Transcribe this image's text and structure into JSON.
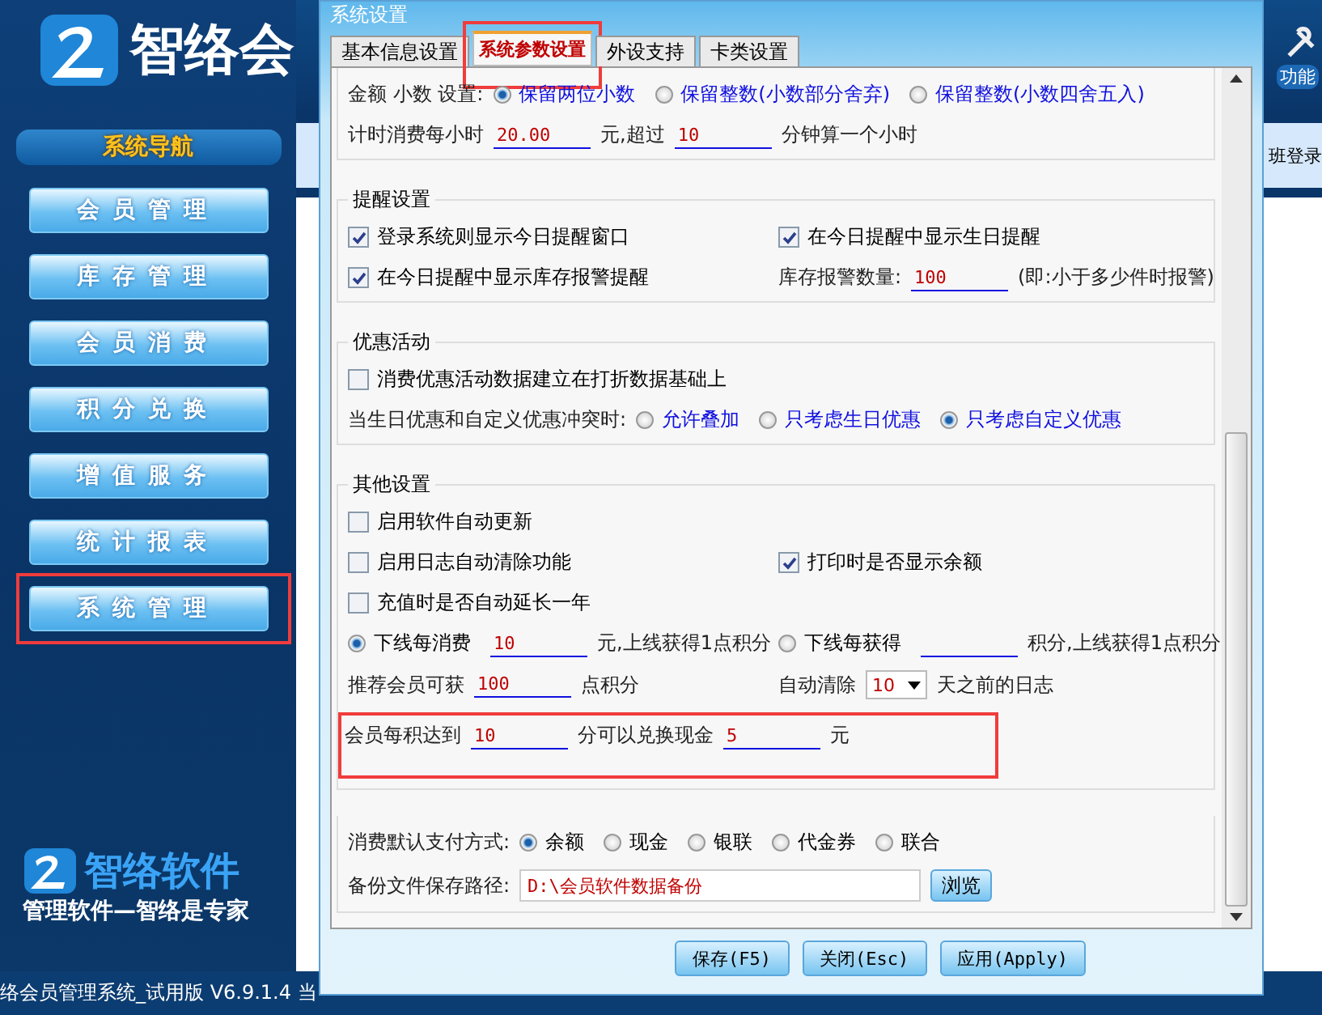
{
  "app": {
    "logo_text": "智络会",
    "nav_title": "系统导航",
    "nav_items": [
      {
        "label": "会员管理",
        "highlighted": false
      },
      {
        "label": "库存管理",
        "highlighted": false
      },
      {
        "label": "会员消费",
        "highlighted": false
      },
      {
        "label": "积分兑换",
        "highlighted": false
      },
      {
        "label": "增值服务",
        "highlighted": false
      },
      {
        "label": "统计报表",
        "highlighted": false
      },
      {
        "label": "系统管理",
        "highlighted": true
      }
    ],
    "brand_name": "智络软件",
    "slogan": "管理软件—智络是专家",
    "toolbar_label": "功能",
    "login_label": "班登录",
    "status_text": "络会员管理系统_试用版 V6.9.1.4 当"
  },
  "dialog": {
    "title": "系统设置",
    "tabs": [
      {
        "label": "基本信息设置",
        "selected": false,
        "highlighted": false
      },
      {
        "label": "系统参数设置",
        "selected": true,
        "highlighted": true
      },
      {
        "label": "外设支持",
        "selected": false,
        "highlighted": false
      },
      {
        "label": "卡类设置",
        "selected": false,
        "highlighted": false
      }
    ],
    "sections": [
      {
        "rows": [
          {
            "left": [
              {
                "kind": "label",
                "text": "金额 小数 设置:"
              },
              {
                "kind": "radio",
                "text": "保留两位小数",
                "selected": true,
                "accent": true
              },
              {
                "kind": "radio",
                "text": "保留整数(小数部分舍弃)",
                "selected": false,
                "accent": true
              },
              {
                "kind": "radio",
                "text": "保留整数(小数四舍五入)",
                "selected": false,
                "accent": true
              }
            ]
          },
          {
            "left": [
              {
                "kind": "label",
                "text": "计时消费每小时"
              },
              {
                "kind": "field",
                "value": "20.00"
              },
              {
                "kind": "label",
                "text": "元,超过"
              },
              {
                "kind": "field",
                "value": "10"
              },
              {
                "kind": "label",
                "text": "分钟算一个小时"
              }
            ]
          }
        ]
      },
      {
        "title": "提醒设置",
        "rows": [
          {
            "left": [
              {
                "kind": "checkbox",
                "text": "登录系统则显示今日提醒窗口",
                "checked": true
              }
            ],
            "right": [
              {
                "kind": "checkbox",
                "text": "在今日提醒中显示生日提醒",
                "checked": true
              }
            ]
          },
          {
            "left": [
              {
                "kind": "checkbox",
                "text": "在今日提醒中显示库存报警提醒",
                "checked": true
              }
            ],
            "right": [
              {
                "kind": "label",
                "text": "库存报警数量:"
              },
              {
                "kind": "field",
                "value": "100"
              },
              {
                "kind": "label",
                "text": "(即:小于多少件时报警)"
              }
            ]
          }
        ]
      },
      {
        "title": "优惠活动",
        "rows": [
          {
            "left": [
              {
                "kind": "checkbox",
                "text": "消费优惠活动数据建立在打折数据基础上",
                "checked": false
              }
            ]
          },
          {
            "left": [
              {
                "kind": "label",
                "text": "当生日优惠和自定义优惠冲突时:"
              },
              {
                "kind": "radio",
                "text": "允许叠加",
                "selected": false,
                "accent": true
              },
              {
                "kind": "radio",
                "text": "只考虑生日优惠",
                "selected": false,
                "accent": true
              },
              {
                "kind": "radio",
                "text": "只考虑自定义优惠",
                "selected": true,
                "accent": true
              }
            ]
          }
        ]
      },
      {
        "title": "其他设置",
        "rows": [
          {
            "left": [
              {
                "kind": "checkbox",
                "text": "启用软件自动更新",
                "checked": false
              }
            ]
          },
          {
            "left": [
              {
                "kind": "checkbox",
                "text": "启用日志自动清除功能",
                "checked": false
              }
            ],
            "right": [
              {
                "kind": "checkbox",
                "text": "打印时是否显示余额",
                "checked": true
              }
            ]
          },
          {
            "left": [
              {
                "kind": "checkbox",
                "text": "充值时是否自动延长一年",
                "checked": false
              }
            ]
          },
          {
            "left": [
              {
                "kind": "radio",
                "text": "下线每消费",
                "selected": true,
                "accent": false
              },
              {
                "kind": "field",
                "value": "10"
              },
              {
                "kind": "label",
                "text": "元,上线获得1点积分"
              }
            ],
            "right": [
              {
                "kind": "radio",
                "text": "下线每获得",
                "selected": false,
                "accent": false
              },
              {
                "kind": "field"
              },
              {
                "kind": "label",
                "text": "积分,上线获得1点积分"
              }
            ]
          },
          {
            "left": [
              {
                "kind": "label",
                "text": "推荐会员可获"
              },
              {
                "kind": "field",
                "value": "100"
              },
              {
                "kind": "label",
                "text": "点积分"
              }
            ],
            "right": [
              {
                "kind": "label",
                "text": "自动清除"
              },
              {
                "kind": "select",
                "value": "10"
              },
              {
                "kind": "label",
                "text": "天之前的日志"
              }
            ]
          },
          {
            "highlighted": true,
            "left": [
              {
                "kind": "label",
                "text": "会员每积达到"
              },
              {
                "kind": "field",
                "value": "10"
              },
              {
                "kind": "label",
                "text": "分可以兑换现金"
              },
              {
                "kind": "field",
                "value": "5"
              },
              {
                "kind": "label",
                "text": "元"
              }
            ]
          }
        ]
      },
      {
        "rows": [
          {
            "left": [
              {
                "kind": "label",
                "text": "消费默认支付方式:"
              },
              {
                "kind": "radio",
                "text": "余额",
                "selected": true,
                "accent": false
              },
              {
                "kind": "radio",
                "text": "现金",
                "selected": false,
                "accent": false
              },
              {
                "kind": "radio",
                "text": "银联",
                "selected": false,
                "accent": false
              },
              {
                "kind": "radio",
                "text": "代金券",
                "selected": false,
                "accent": false
              },
              {
                "kind": "radio",
                "text": "联合",
                "selected": false,
                "accent": false
              }
            ]
          },
          {
            "left": [
              {
                "kind": "label",
                "text": "备份文件保存路径:"
              },
              {
                "kind": "path",
                "value": "D:\\会员软件数据备份"
              },
              {
                "kind": "button",
                "text": "浏览"
              }
            ]
          }
        ]
      }
    ],
    "buttons": [
      "保存(F5)",
      "关闭(Esc)",
      "应用(Apply)"
    ]
  }
}
